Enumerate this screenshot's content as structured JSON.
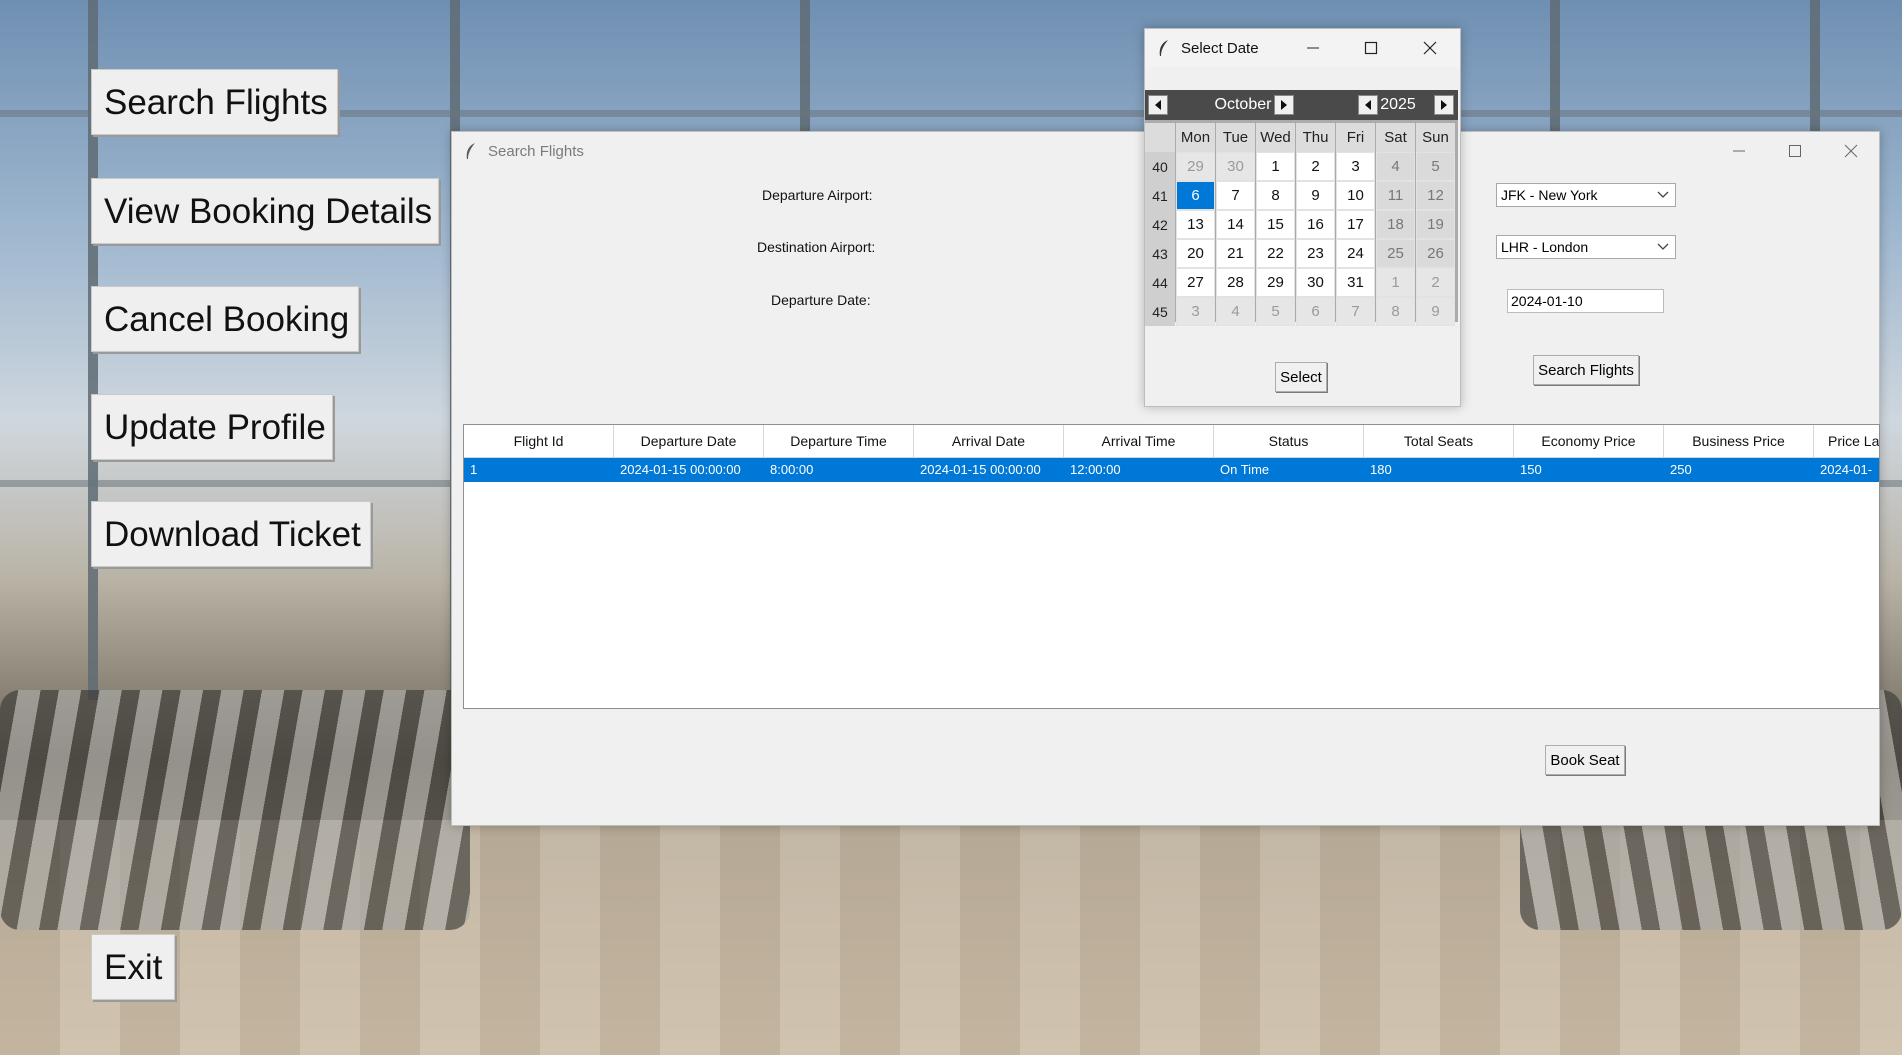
{
  "menu": {
    "search_flights": "Search Flights",
    "view_booking": "View Booking Details",
    "cancel_booking": "Cancel Booking",
    "update_profile": "Update Profile",
    "download_ticket": "Download Ticket",
    "exit": "Exit"
  },
  "search_window": {
    "title": "Search Flights",
    "departure_label": "Departure Airport:",
    "destination_label": "Destination Airport:",
    "date_label": "Departure Date:",
    "departure_value": "JFK - New York",
    "destination_value": "LHR - London",
    "date_value": "2024-01-10",
    "search_button": "Search Flights",
    "book_button": "Book Seat",
    "table": {
      "columns": [
        "Flight Id",
        "Departure Date",
        "Departure Time",
        "Arrival Date",
        "Arrival Time",
        "Status",
        "Total Seats",
        "Economy Price",
        "Business Price",
        "Price La"
      ],
      "rows": [
        [
          "1",
          "2024-01-15 00:00:00",
          "8:00:00",
          "2024-01-15 00:00:00",
          "12:00:00",
          "On Time",
          "180",
          "150",
          "250",
          "2024-01-"
        ]
      ]
    }
  },
  "date_dialog": {
    "title": "Select Date",
    "month": "October",
    "year": "2025",
    "select_button": "Select",
    "weekdays": [
      "Mon",
      "Tue",
      "Wed",
      "Thu",
      "Fri",
      "Sat",
      "Sun"
    ],
    "weeks": [
      {
        "num": "40",
        "days": [
          "29",
          "30",
          "1",
          "2",
          "3",
          "4",
          "5"
        ]
      },
      {
        "num": "41",
        "days": [
          "6",
          "7",
          "8",
          "9",
          "10",
          "11",
          "12"
        ]
      },
      {
        "num": "42",
        "days": [
          "13",
          "14",
          "15",
          "16",
          "17",
          "18",
          "19"
        ]
      },
      {
        "num": "43",
        "days": [
          "20",
          "21",
          "22",
          "23",
          "24",
          "25",
          "26"
        ]
      },
      {
        "num": "44",
        "days": [
          "27",
          "28",
          "29",
          "30",
          "31",
          "1",
          "2"
        ]
      },
      {
        "num": "45",
        "days": [
          "3",
          "4",
          "5",
          "6",
          "7",
          "8",
          "9"
        ]
      }
    ],
    "selected_day": "6"
  },
  "colors": {
    "selection": "#0078d7",
    "window_bg": "#f0f0f0"
  }
}
